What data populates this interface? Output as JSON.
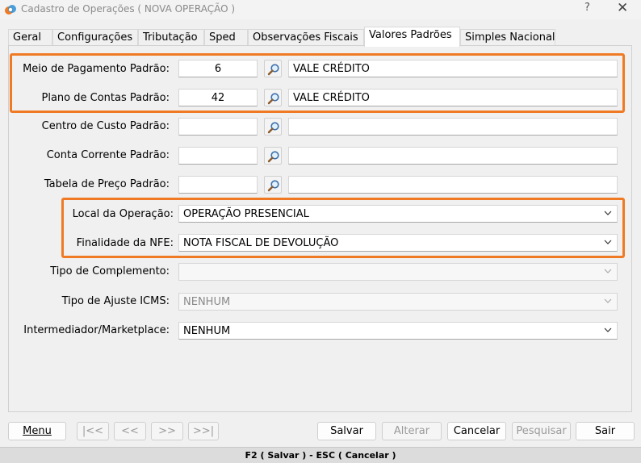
{
  "window": {
    "title": "Cadastro de Operações ( NOVA OPERAÇÃO )",
    "help": "?",
    "close": "✕"
  },
  "tabs": [
    {
      "label": "Geral"
    },
    {
      "label": "Configurações"
    },
    {
      "label": "Tributação"
    },
    {
      "label": "Sped"
    },
    {
      "label": "Observações Fiscais"
    },
    {
      "label": "Valores Padrões",
      "active": true
    },
    {
      "label": "Simples Nacional"
    }
  ],
  "form": {
    "meio_pagamento": {
      "label": "Meio de Pagamento Padrão:",
      "code": "6",
      "desc": "VALE CRÉDITO"
    },
    "plano_contas": {
      "label": "Plano de Contas Padrão:",
      "code": "42",
      "desc": "VALE CRÉDITO"
    },
    "centro_custo": {
      "label": "Centro de Custo Padrão:",
      "code": "",
      "desc": ""
    },
    "conta_corrente": {
      "label": "Conta Corrente Padrão:",
      "code": "",
      "desc": ""
    },
    "tabela_preco": {
      "label": "Tabela de Preço Padrão:",
      "code": "",
      "desc": ""
    },
    "local_operacao": {
      "label": "Local da Operação:",
      "value": "OPERAÇÃO PRESENCIAL"
    },
    "finalidade_nfe": {
      "label": "Finalidade da NFE:",
      "value": "NOTA FISCAL DE DEVOLUÇÃO"
    },
    "tipo_complemento": {
      "label": "Tipo de Complemento:",
      "value": ""
    },
    "tipo_ajuste_icms": {
      "label": "Tipo de Ajuste ICMS:",
      "value": "NENHUM"
    },
    "intermediador": {
      "label": "Intermediador/Marketplace:",
      "value": "NENHUM"
    }
  },
  "buttons": {
    "menu": "Menu",
    "first": "|<<",
    "prev": "<<",
    "next": ">>",
    "last": ">>|",
    "salvar": "Salvar",
    "alterar": "Alterar",
    "cancelar": "Cancelar",
    "pesquisar": "Pesquisar",
    "sair": "Sair"
  },
  "status": "F2 ( Salvar )  -  ESC ( Cancelar )",
  "colors": {
    "highlight": "#f07a24",
    "accent": "#e8762b"
  },
  "icons": [
    "app-logo-icon",
    "magnifier-icon",
    "chevron-down-icon"
  ]
}
